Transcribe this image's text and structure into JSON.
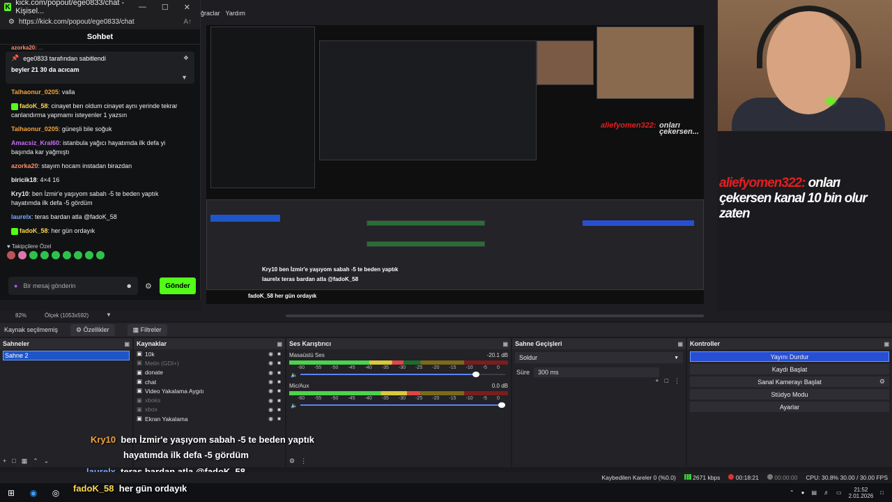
{
  "chat_window": {
    "title": "kick.com/popout/ege0833/chat - Kişisel...",
    "url": "https://kick.com/popout/ege0833/chat",
    "header": "Sohbet",
    "pinned_by": "ege0833 tarafından sabitlendi",
    "pinned_message": "beyler 21 30 da acıcam",
    "messages": [
      {
        "user": "Talhaonur_0205",
        "color": "orange",
        "text": "valla"
      },
      {
        "user": "fadoK_58",
        "color": "yellow",
        "text": "cinayet ben oldum cinayet aynı yerinde tekrar canlandırma yapmamı isteyenler 1 yazsın"
      },
      {
        "user": "Talhaonur_0205",
        "color": "orange",
        "text": "güneşli bile soğuk"
      },
      {
        "user": "Amacsiz_Kral60",
        "color": "purple",
        "text": "istanbula yağıcı hayatımda ilk defa yi başında kar yağmıştı"
      },
      {
        "user": "azorka20",
        "color": "coral",
        "text": "stayım hocam instadan birazdan"
      },
      {
        "user": "biricik18",
        "color": "white",
        "text": "4×4 16"
      },
      {
        "user": "Kry10",
        "color": "white",
        "text": "ben İzmir'e yaşıyom sabah -5 te beden yaptık hayatımda ilk defa -5 gördüm"
      },
      {
        "user": "laurelx",
        "color": "blue",
        "text": "teras bardan atla @fadoK_58"
      },
      {
        "user": "fadoK_58",
        "color": "yellow",
        "text": "her gün ordayık"
      }
    ],
    "followers_label": "Takipçilere Özel",
    "input_placeholder": "Bir mesaj gönderin",
    "send_label": "Gönder"
  },
  "obs": {
    "menu": [
      "ğraclar",
      "Yardım"
    ],
    "zoom": "82%",
    "preview_label": "Ölçek (1053x592)",
    "source_bar": {
      "no_source": "Kaynak seçilmemiş",
      "properties": "Özellikler",
      "filters": "Filtreler"
    },
    "scenes": {
      "header": "Sahneler",
      "items": [
        "Sahne 2"
      ]
    },
    "sources": {
      "header": "Kaynaklar",
      "items": [
        {
          "name": "10k",
          "dim": false
        },
        {
          "name": "Metin (GDI+)",
          "dim": true
        },
        {
          "name": "donate",
          "dim": false
        },
        {
          "name": "chat",
          "dim": false
        },
        {
          "name": "Video Yakalama Aygıtı",
          "dim": false
        },
        {
          "name": "xboks",
          "dim": true
        },
        {
          "name": "xbox",
          "dim": true
        },
        {
          "name": "Ekran Yakalama",
          "dim": false
        }
      ]
    },
    "mixer": {
      "header": "Ses Karıştırıcı",
      "channels": [
        {
          "name": "Masaüstü Ses",
          "db": "-20.1 dB",
          "level": 0.87
        },
        {
          "name": "Mic/Aux",
          "db": "0.0 dB",
          "level": 1.0
        }
      ],
      "ticks": [
        "-60",
        "-55",
        "-50",
        "-45",
        "-40",
        "-35",
        "-30",
        "-25",
        "-20",
        "-15",
        "-10",
        "-5",
        "0"
      ]
    },
    "transitions": {
      "header": "Sahne Geçişleri",
      "selected": "Soldur",
      "duration_label": "Süre",
      "duration": "300 ms"
    },
    "controls": {
      "header": "Kontroller",
      "buttons": [
        "Yayını Durdur",
        "Kaydı Başlat",
        "Sanal Kamerayı Başlat",
        "Stüdyo Modu",
        "Ayarlar"
      ]
    },
    "status": {
      "dropped": "Kaybedilen Kareler 0 (%0.0)",
      "bitrate": "2671 kbps",
      "live_time": "00:18:21",
      "rec_time": "00:00:00",
      "cpu": "CPU: 30.8%  30.00 / 30.00 FPS"
    }
  },
  "overlay": {
    "red_text": "aliefyomen322:",
    "red_rest": "onları çekersen kanal 10 bin olur zaten",
    "subtitles": [
      {
        "user": "Kry10",
        "text": "ben İzmir'e yaşıyom sabah -5 te beden yaptık"
      },
      {
        "user": "",
        "text": "hayatımda ilk defa -5 gördüm"
      },
      {
        "user": "laurelx",
        "text": "teras bardan atla @fadoK_58"
      },
      {
        "user": "fadoK_58",
        "text": "her gün ordayık"
      }
    ]
  },
  "taskbar": {
    "time": "21:52",
    "date": "2.01.2026"
  }
}
